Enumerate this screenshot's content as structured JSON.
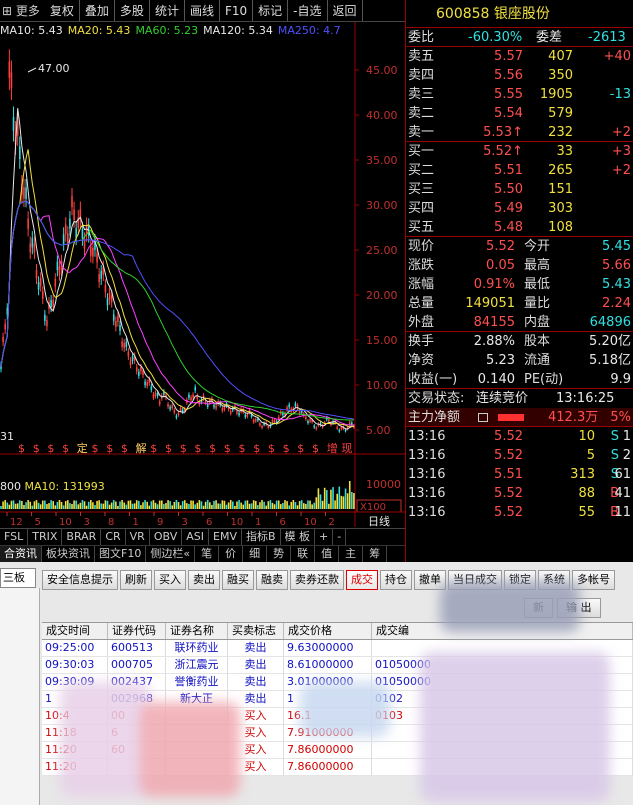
{
  "topbar": {
    "menu": "更多",
    "buttons": [
      "复权",
      "叠加",
      "多股",
      "统计",
      "画线",
      "F10",
      "标记",
      "-自选",
      "返回"
    ]
  },
  "legend": [
    {
      "text": "MA10: 5.43",
      "color": "#e8e8e8"
    },
    {
      "text": "MA20: 5.43",
      "color": "#f0e040"
    },
    {
      "text": "MA60: 5.23",
      "color": "#30d030"
    },
    {
      "text": "MA120: 5.34",
      "color": "#e8e8e8"
    },
    {
      "text": "MA250: 4.7",
      "color": "#5050ff"
    }
  ],
  "chart": {
    "high_label": "47.00",
    "axis_labels": [
      "45.00",
      "40.00",
      "35.00",
      "30.00",
      "25.00",
      "20.00",
      "15.00",
      "10.00",
      "5.00"
    ],
    "corner_label": "31",
    "event_marks": [
      "$",
      "$",
      "$",
      "$",
      "定",
      "$",
      "$",
      "$",
      "解",
      "$",
      "$",
      "$",
      "$",
      "$",
      "$",
      "$",
      "$",
      "$",
      "$",
      "$",
      "$",
      "增",
      "现"
    ]
  },
  "volume": {
    "legend_vol": "800",
    "legend_ma": "MA10: 131993",
    "axis_label": "10000",
    "unit_label": "X100",
    "x_ticks": [
      "12",
      "5",
      "10",
      "3",
      "8",
      "1",
      "9",
      "3",
      "6",
      "10",
      "1",
      "6",
      "10",
      "2"
    ],
    "period_label": "日线"
  },
  "indicator_tabs": [
    "FSL",
    "TRIX",
    "BRAR",
    "CR",
    "VR",
    "OBV",
    "ASI",
    "EMV",
    "指标B",
    "模 板",
    "+",
    "-"
  ],
  "sub_tabs": [
    "合资讯",
    "板块资讯",
    "图文F10",
    "侧边栏«",
    "笔",
    "价",
    "细",
    "势",
    "联",
    "值",
    "主",
    "筹"
  ],
  "quote": {
    "code": "600858",
    "name": "银座股份",
    "webi_label": "委比",
    "webi_value": "-60.30%",
    "weicha_label": "委差",
    "weicha_value": "-2613",
    "asks": [
      {
        "label": "卖五",
        "price": "5.57",
        "vol": "407",
        "chg": "+40"
      },
      {
        "label": "卖四",
        "price": "5.56",
        "vol": "350",
        "chg": ""
      },
      {
        "label": "卖三",
        "price": "5.55",
        "vol": "1905",
        "chg": "-13"
      },
      {
        "label": "卖二",
        "price": "5.54",
        "vol": "579",
        "chg": ""
      },
      {
        "label": "卖一",
        "price": "5.53↑",
        "vol": "232",
        "chg": "+2"
      }
    ],
    "bids": [
      {
        "label": "买一",
        "price": "5.52↑",
        "vol": "33",
        "chg": "+3"
      },
      {
        "label": "买二",
        "price": "5.51",
        "vol": "265",
        "chg": "+2"
      },
      {
        "label": "买三",
        "price": "5.50",
        "vol": "151",
        "chg": ""
      },
      {
        "label": "买四",
        "price": "5.49",
        "vol": "303",
        "chg": ""
      },
      {
        "label": "买五",
        "price": "5.48",
        "vol": "108",
        "chg": ""
      }
    ],
    "stats": [
      {
        "l1": "现价",
        "v1": "5.52",
        "l2": "今开",
        "v2": "5.45"
      },
      {
        "l1": "涨跌",
        "v1": "0.05",
        "l2": "最高",
        "v2": "5.66"
      },
      {
        "l1": "涨幅",
        "v1": "0.91%",
        "l2": "最低",
        "v2": "5.43"
      },
      {
        "l1": "总量",
        "v1": "149051",
        "l2": "量比",
        "v2": "2.24"
      },
      {
        "l1": "外盘",
        "v1": "84155",
        "l2": "内盘",
        "v2": "64896"
      }
    ],
    "stats2": [
      {
        "l1": "换手",
        "v1": "2.88%",
        "l2": "股本",
        "v2": "5.20亿"
      },
      {
        "l1": "净资",
        "v1": "5.23",
        "l2": "流通",
        "v2": "5.18亿"
      },
      {
        "l1": "收益(一)",
        "v1": "0.140",
        "l2": "PE(动)",
        "v2": "9.9"
      }
    ],
    "trade_status_label": "交易状态:",
    "trade_status": "连续竞价",
    "trade_time": "13:16:25",
    "main_flow_label": "主力净额",
    "main_flow_value": "412.3万",
    "main_flow_pct": "5%",
    "ticks": [
      {
        "t": "13:16",
        "p": "5.52",
        "v": "10",
        "s": "S",
        "n": "1"
      },
      {
        "t": "13:16",
        "p": "5.52",
        "v": "5",
        "s": "S",
        "n": "2"
      },
      {
        "t": "13:16",
        "p": "5.51",
        "v": "313",
        "s": "S",
        "n": "61"
      },
      {
        "t": "13:16",
        "p": "5.52",
        "v": "88",
        "s": "B",
        "n": "41"
      },
      {
        "t": "13:16",
        "p": "5.52",
        "v": "55",
        "s": "B",
        "n": "11"
      }
    ]
  },
  "trade": {
    "side_tab": "三板",
    "buttons": [
      "安全信息提示",
      "刷新",
      "买入",
      "卖出",
      "融买",
      "融卖",
      "卖券还款",
      "成交",
      "持仓",
      "撤单",
      "当日成交",
      "锁定",
      "系统",
      "多帐号"
    ],
    "active_button": "成交",
    "refresh_buttons": [
      "新",
      "输 出"
    ],
    "columns": [
      "成交时间",
      "证券代码",
      "证券名称",
      "买卖标志",
      "成交价格",
      "成交编"
    ],
    "rows": [
      {
        "time": "09:25:00",
        "code": "600513",
        "name": "联环药业",
        "flag": "卖出",
        "price": "9.63000000",
        "no": "",
        "side": "sell"
      },
      {
        "time": "09:30:03",
        "code": "000705",
        "name": "浙江震元",
        "flag": "卖出",
        "price": "8.61000000",
        "no": "01050000",
        "side": "sell"
      },
      {
        "time": "09:30:09",
        "code": "002437",
        "name": "誉衡药业",
        "flag": "卖出",
        "price": "3.01000000",
        "no": "01050000",
        "side": "sell"
      },
      {
        "time": "1",
        "code": "002968",
        "name": "新大正",
        "flag": "卖出",
        "price": "1",
        "no": "0102",
        "side": "sell"
      },
      {
        "time": "10:4",
        "code": "00",
        "name": "",
        "flag": "买入",
        "price": "16.1",
        "no": "0103",
        "side": "buy"
      },
      {
        "time": "11:18",
        "code": "6",
        "name": "",
        "flag": "买入",
        "price": "7.91000000",
        "no": "",
        "side": "buy"
      },
      {
        "time": "11:20",
        "code": "60",
        "name": "",
        "flag": "买入",
        "price": "7.86000000",
        "no": "",
        "side": "buy"
      },
      {
        "time": "11:20",
        "code": "",
        "name": "",
        "flag": "买入",
        "price": "7.86000000",
        "no": "",
        "side": "buy"
      }
    ]
  },
  "colors": {
    "up": "#ff5050",
    "down": "#30e0e0",
    "ma250": "#5050ff",
    "panel_border": "#990000"
  }
}
